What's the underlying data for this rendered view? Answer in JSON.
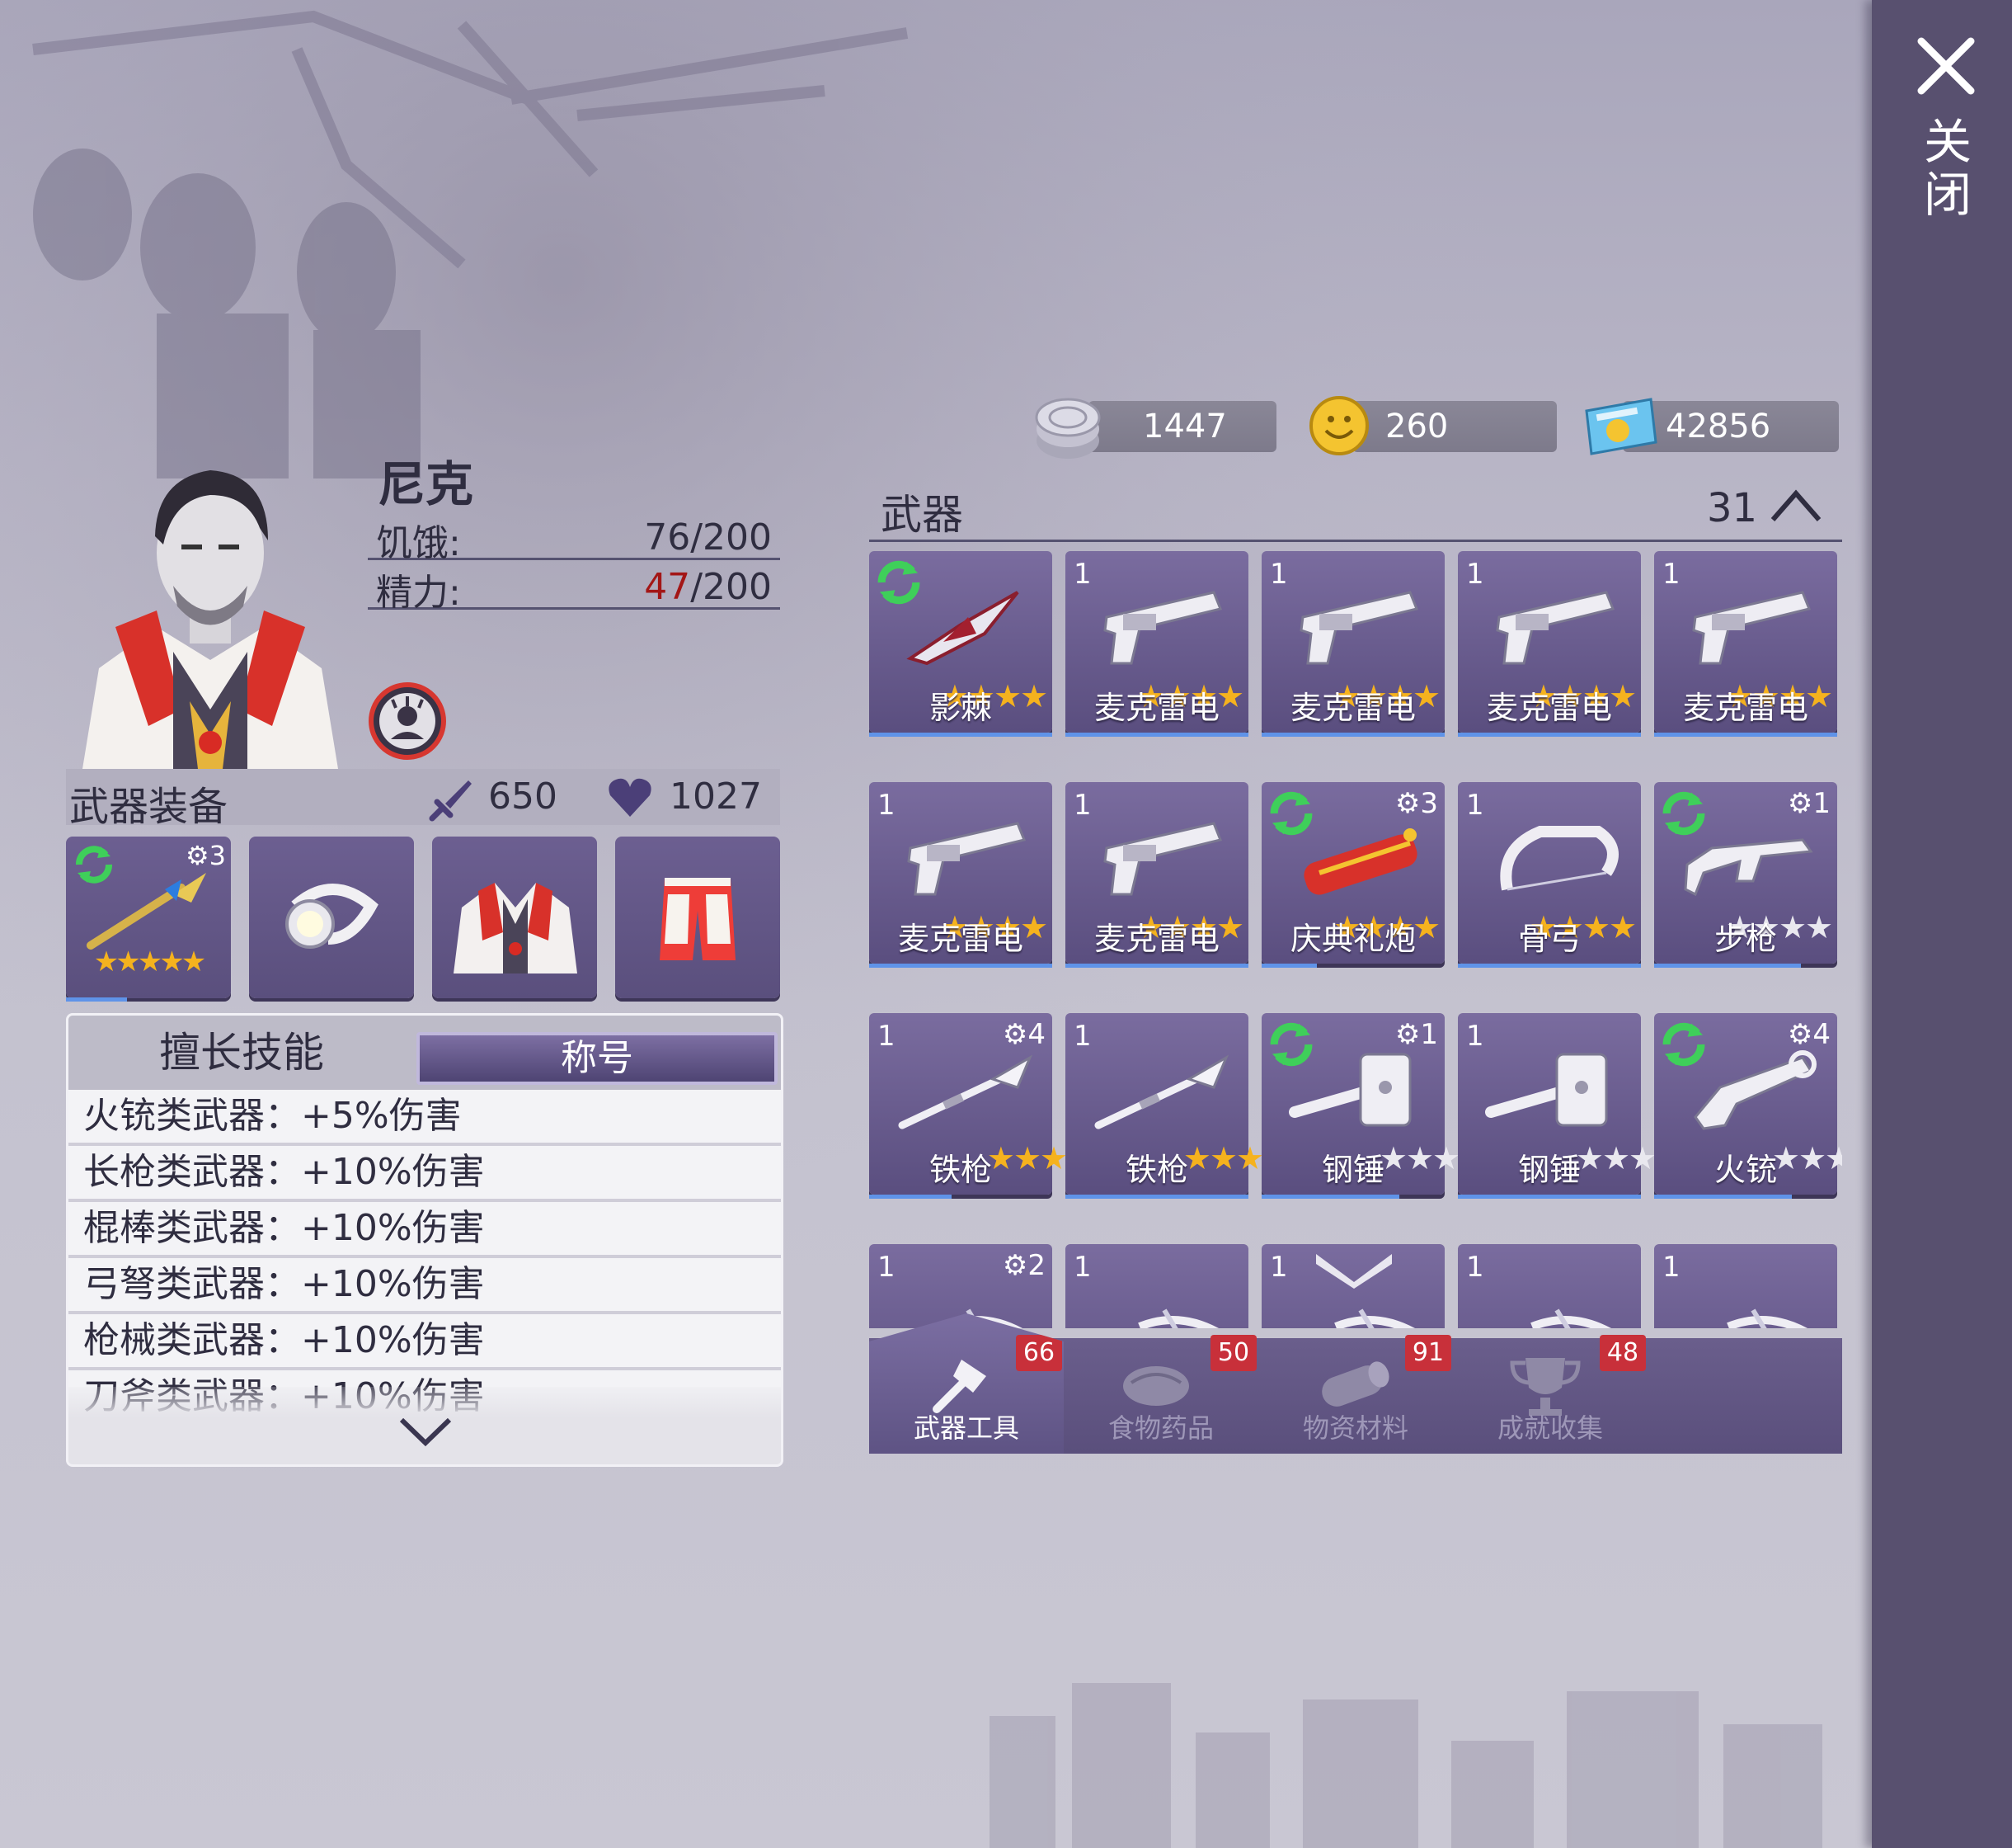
{
  "close_label": "关闭",
  "character": {
    "name": "尼克",
    "hunger_label": "饥饿:",
    "hunger_value": "76/200",
    "energy_label": "精力:",
    "energy_current": "47",
    "energy_max": "/200"
  },
  "equipment": {
    "title": "武器装备",
    "attack": "650",
    "health": "1027",
    "slots": [
      {
        "icon": "golden-spear-icon",
        "upgrade": "3",
        "stars": 5,
        "progress": 0.35
      },
      {
        "icon": "headlamp-icon"
      },
      {
        "icon": "jacket-icon"
      },
      {
        "icon": "shorts-icon"
      }
    ]
  },
  "skills": {
    "tab_active": "擅长技能",
    "tab_other": "称号",
    "rows": [
      "火铳类武器：+5%伤害",
      "长枪类武器：+10%伤害",
      "棍棒类武器：+10%伤害",
      "弓弩类武器：+10%伤害",
      "枪械类武器：+10%伤害",
      "刀斧类武器：+10%伤害"
    ]
  },
  "currency": [
    {
      "icon": "silver-coin-icon",
      "value": "1447"
    },
    {
      "icon": "gold-coin-icon",
      "value": "260"
    },
    {
      "icon": "ticket-icon",
      "value": "42856"
    }
  ],
  "weapons": {
    "title": "武器",
    "count": "31",
    "items": [
      {
        "name": "影棘",
        "num": "",
        "level": "",
        "refresh": true,
        "stars": 4,
        "gold": true,
        "icon": "blade-icon",
        "progress": 1
      },
      {
        "name": "麦克雷电",
        "num": "1",
        "level": "",
        "refresh": false,
        "stars": 4,
        "gold": true,
        "icon": "revolver-icon",
        "progress": 1
      },
      {
        "name": "麦克雷电",
        "num": "1",
        "level": "",
        "refresh": false,
        "stars": 4,
        "gold": true,
        "icon": "revolver-icon",
        "progress": 1
      },
      {
        "name": "麦克雷电",
        "num": "1",
        "level": "",
        "refresh": false,
        "stars": 4,
        "gold": true,
        "icon": "revolver-icon",
        "progress": 1
      },
      {
        "name": "麦克雷电",
        "num": "1",
        "level": "",
        "refresh": false,
        "stars": 4,
        "gold": true,
        "icon": "revolver-icon",
        "progress": 1
      },
      {
        "name": "麦克雷电",
        "num": "1",
        "level": "",
        "refresh": false,
        "stars": 4,
        "gold": true,
        "icon": "revolver-icon",
        "progress": 1
      },
      {
        "name": "麦克雷电",
        "num": "1",
        "level": "",
        "refresh": false,
        "stars": 4,
        "gold": true,
        "icon": "revolver-icon",
        "progress": 1
      },
      {
        "name": "庆典礼炮",
        "num": "",
        "level": "3",
        "refresh": true,
        "stars": 4,
        "gold": true,
        "icon": "firecracker-icon",
        "progress": 0.3
      },
      {
        "name": "骨弓",
        "num": "1",
        "level": "",
        "refresh": false,
        "stars": 4,
        "gold": true,
        "icon": "bone-bow-icon",
        "progress": 1
      },
      {
        "name": "步枪",
        "num": "",
        "level": "1",
        "refresh": true,
        "stars": 4,
        "gold": false,
        "icon": "rifle-icon",
        "progress": 0.8
      },
      {
        "name": "铁枪",
        "num": "1",
        "level": "4",
        "refresh": false,
        "stars": 3,
        "gold": true,
        "icon": "iron-spear-icon",
        "progress": 0.45
      },
      {
        "name": "铁枪",
        "num": "1",
        "level": "",
        "refresh": false,
        "stars": 3,
        "gold": true,
        "icon": "iron-spear-icon",
        "progress": 1
      },
      {
        "name": "钢锤",
        "num": "",
        "level": "1",
        "refresh": true,
        "stars": 3,
        "gold": false,
        "icon": "hammer-icon",
        "progress": 0.75
      },
      {
        "name": "钢锤",
        "num": "1",
        "level": "",
        "refresh": false,
        "stars": 3,
        "gold": false,
        "icon": "hammer-icon",
        "progress": 1
      },
      {
        "name": "火铳",
        "num": "",
        "level": "4",
        "refresh": true,
        "stars": 3,
        "gold": false,
        "icon": "blunderbuss-icon",
        "progress": 0.75
      },
      {
        "name": "",
        "num": "1",
        "level": "2",
        "refresh": false,
        "stars": 0,
        "gold": false,
        "icon": "crossbow-icon",
        "progress": 0
      },
      {
        "name": "",
        "num": "1",
        "level": "",
        "refresh": false,
        "stars": 0,
        "gold": false,
        "icon": "crossbow-icon",
        "progress": 0
      },
      {
        "name": "",
        "num": "1",
        "level": "",
        "refresh": false,
        "stars": 0,
        "gold": false,
        "icon": "crossbow-icon",
        "progress": 0
      },
      {
        "name": "",
        "num": "1",
        "level": "",
        "refresh": false,
        "stars": 0,
        "gold": false,
        "icon": "crossbow-icon",
        "progress": 0
      },
      {
        "name": "",
        "num": "1",
        "level": "",
        "refresh": false,
        "stars": 0,
        "gold": false,
        "icon": "crossbow-icon",
        "progress": 0
      }
    ]
  },
  "tabs": [
    {
      "label": "武器工具",
      "count": "66",
      "icon": "axe-icon",
      "active": true
    },
    {
      "label": "食物药品",
      "count": "50",
      "icon": "meat-icon",
      "active": false
    },
    {
      "label": "物资材料",
      "count": "91",
      "icon": "log-icon",
      "active": false
    },
    {
      "label": "成就收集",
      "count": "48",
      "icon": "trophy-icon",
      "active": false
    }
  ],
  "colors": {
    "panel_purple": "#5a4e7f",
    "gold_star": "#f5b21e",
    "health_red": "#a31616",
    "badge_red": "#c8303a",
    "refresh_green": "#3fcf5a"
  }
}
